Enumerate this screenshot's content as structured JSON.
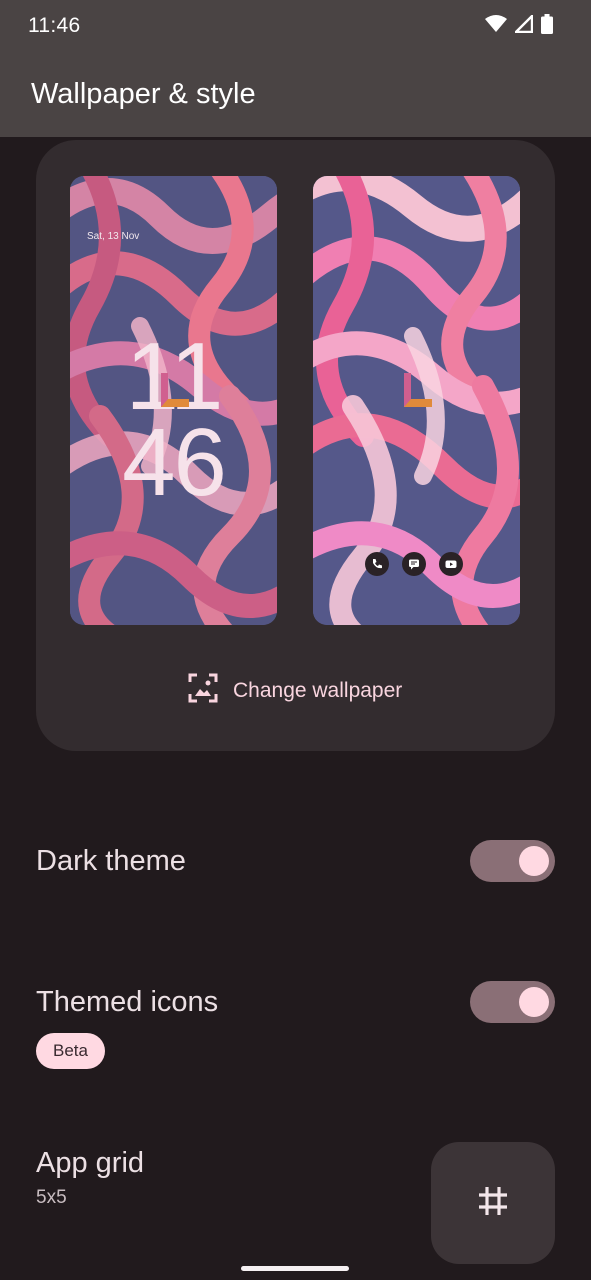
{
  "status_bar": {
    "time": "11:46",
    "icons": [
      "wifi-icon",
      "signal-icon",
      "battery-icon"
    ]
  },
  "app_bar": {
    "title": "Wallpaper & style"
  },
  "preview": {
    "lock_screen": {
      "date": "Sat, 13 Nov",
      "clock_hours": "11",
      "clock_minutes": "46"
    },
    "home_screen": {
      "dock_icons": [
        "phone-icon",
        "messages-icon",
        "youtube-icon"
      ]
    },
    "change_wallpaper_label": "Change wallpaper"
  },
  "settings": {
    "dark_theme": {
      "label": "Dark theme",
      "enabled": true
    },
    "themed_icons": {
      "label": "Themed icons",
      "badge": "Beta",
      "enabled": true
    },
    "app_grid": {
      "label": "App grid",
      "value": "5x5"
    }
  },
  "colors": {
    "background": "#211a1d",
    "app_bar": "#4a4444",
    "card": "#332c2f",
    "accent": "#ffd9e2",
    "toggle_track": "#8a6f76",
    "accent_text": "#f9d5df"
  }
}
